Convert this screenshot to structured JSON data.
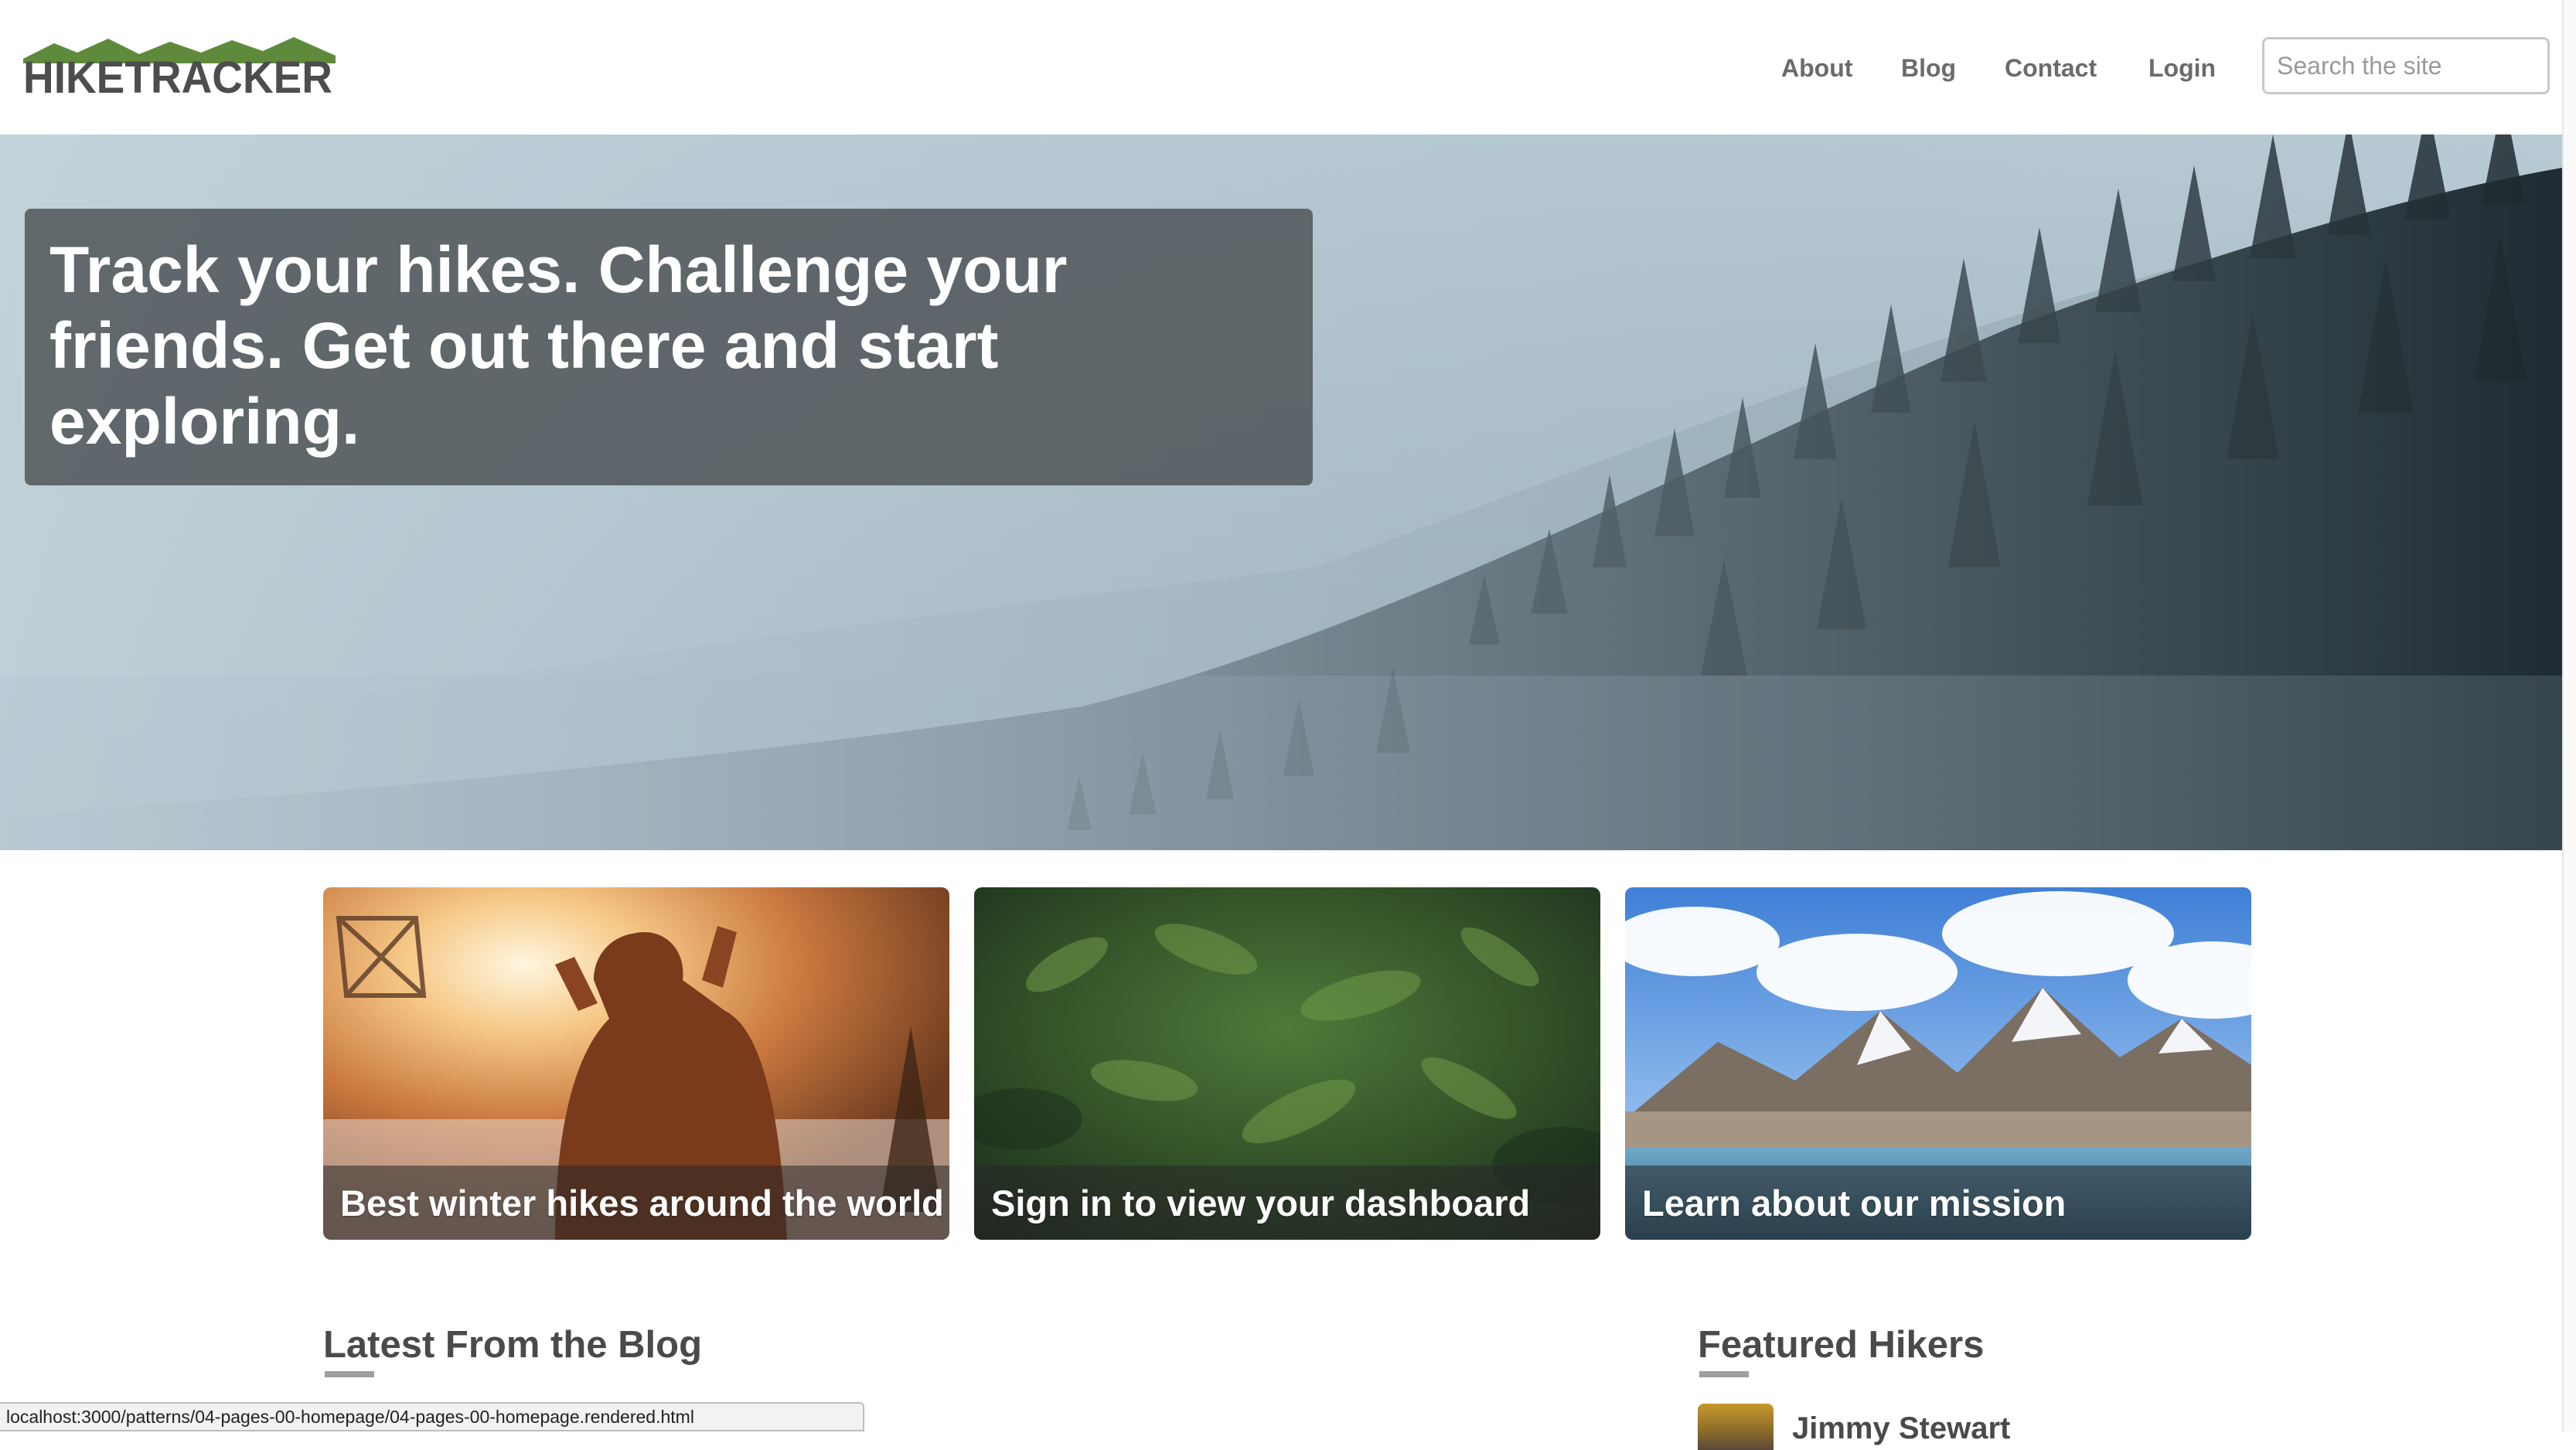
{
  "brand": {
    "name": "HIKETRACKER",
    "colors": {
      "text": "#4d4d4d",
      "mountains": "#5f8a3c"
    }
  },
  "nav": {
    "items": [
      {
        "label": "About"
      },
      {
        "label": "Blog"
      },
      {
        "label": "Contact"
      },
      {
        "label": "Login"
      }
    ]
  },
  "search": {
    "placeholder": "Search the site",
    "value": ""
  },
  "hero": {
    "title": "Track your hikes. Challenge your friends. Get out there and start exploring.",
    "image": "misty-pine-forest-mountainside"
  },
  "cards": [
    {
      "label": "Best winter hikes around the world",
      "image": "hiker-in-winter-sunset"
    },
    {
      "label": "Sign in to view your dashboard",
      "image": "dense-green-foliage"
    },
    {
      "label": "Learn about our mission",
      "image": "snowy-mountains-and-lake"
    }
  ],
  "sections": {
    "blog_heading": "Latest From the Blog",
    "hikers_heading": "Featured Hikers",
    "featured_hiker_name": "Jimmy Stewart"
  },
  "status_bar": {
    "url": "localhost:3000/patterns/04-pages-00-homepage/04-pages-00-homepage.rendered.html"
  },
  "colors": {
    "accent_text": "#4a4a4a",
    "nav_text": "#6b6b6b",
    "rule": "#9e9e9e"
  }
}
